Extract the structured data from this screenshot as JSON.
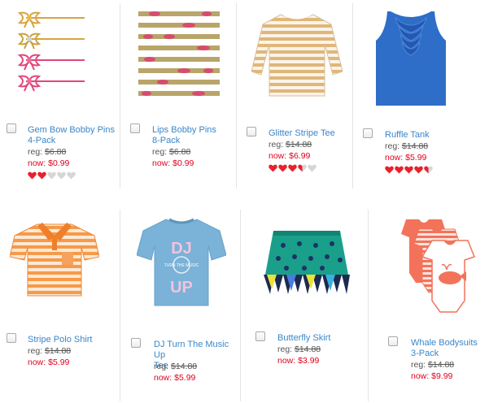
{
  "colors": {
    "link": "#3a86c8",
    "sale": "#e0001b",
    "heart_on": "#e8212c",
    "heart_off": "#d6d6d6",
    "divider": "#e4e4e4"
  },
  "products": [
    {
      "name": "Gem Bow Bobby Pins\n4-Pack",
      "reg_label": "reg:",
      "reg_price": "$6.88",
      "now_label": "now:",
      "now_price": "$0.99",
      "rating": 2,
      "image_icon": "gem-bow-bobby-pins-image"
    },
    {
      "name": "Lips Bobby Pins\n8-Pack",
      "reg_label": "reg:",
      "reg_price": "$6.88",
      "now_label": "now:",
      "now_price": "$0.99",
      "rating": null,
      "image_icon": "lips-bobby-pins-image"
    },
    {
      "name": "Glitter Stripe Tee",
      "reg_label": "reg:",
      "reg_price": "$14.88",
      "now_label": "now:",
      "now_price": "$6.99",
      "rating": 3.5,
      "image_icon": "glitter-stripe-tee-image"
    },
    {
      "name": "Ruffle Tank",
      "reg_label": "reg:",
      "reg_price": "$14.88",
      "now_label": "now:",
      "now_price": "$5.99",
      "rating": 4.5,
      "image_icon": "ruffle-tank-image"
    },
    {
      "name": "Stripe Polo Shirt",
      "reg_label": "reg:",
      "reg_price": "$14.88",
      "now_label": "now:",
      "now_price": "$5.99",
      "rating": null,
      "image_icon": "stripe-polo-shirt-image"
    },
    {
      "name": "DJ Turn The Music Up\nTee",
      "reg_label": "reg:",
      "reg_price": "$14.88",
      "now_label": "now:",
      "now_price": "$5.99",
      "rating": null,
      "image_icon": "dj-tee-image"
    },
    {
      "name": "Butterfly Skirt",
      "reg_label": "reg:",
      "reg_price": "$14.88",
      "now_label": "now:",
      "now_price": "$3.99",
      "rating": null,
      "image_icon": "butterfly-skirt-image"
    },
    {
      "name": "Whale Bodysuits\n3-Pack",
      "reg_label": "reg:",
      "reg_price": "$14.88",
      "now_label": "now:",
      "now_price": "$9.99",
      "rating": null,
      "image_icon": "whale-bodysuits-image"
    }
  ],
  "tee_graphic": {
    "line1": "DJ",
    "line2": "UP",
    "badge": "TURN THE MUSIC"
  }
}
